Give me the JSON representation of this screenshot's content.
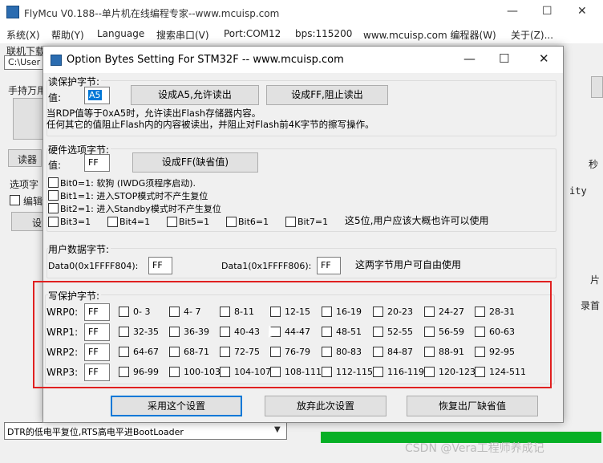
{
  "app": {
    "title": "FlyMcu V0.188--单片机在线编程专家--www.mcuisp.com",
    "menu": [
      "系统(X)",
      "帮助(Y)",
      "Language",
      "搜索串口(V)",
      "Port:COM12",
      "bps:115200",
      "www.mcuisp.com 编程器(W)",
      "关于(Z)..."
    ],
    "left_texts": {
      "online": "联机下载时的程序文件:",
      "path": "C:\\User",
      "handheld": "手持万用",
      "reader": "读器",
      "options": "选项字",
      "edit": "编辑",
      "set": "设"
    },
    "right_texts": {
      "r1": "秒",
      "r2": "ity",
      "r3": "片",
      "r4": "录首"
    },
    "bottom_combo": "DTR的低电平复位,RTS高电平进BootLoader",
    "watermark": "CSDN @Vera工程师养成记"
  },
  "dialog": {
    "title": "Option Bytes Setting For STM32F -- www.mcuisp.com",
    "read_protect": {
      "group_label": "读保护字节:",
      "value_label": "值:",
      "value": "A5",
      "btn_allow": "设成A5,允许读出",
      "btn_block": "设成FF,阻止读出",
      "note1": "当RDP值等于0xA5时，允许读出Flash存储器内容。",
      "note2": "任何其它的值阻止Flash内的内容被读出，并阻止对Flash前4K字节的擦写操作。"
    },
    "hw_options": {
      "group_label": "硬件选项字节:",
      "value_label": "值:",
      "value": "FF",
      "btn_default": "设成FF(缺省值)",
      "bit0": "Bit0=1: 软狗 (IWDG须程序启动).",
      "bit1": "Bit1=1: 进入STOP模式时不产生复位",
      "bit2": "Bit2=1: 进入Standby模式时不产生复位",
      "bit3": "Bit3=1",
      "bit4": "Bit4=1",
      "bit5": "Bit5=1",
      "bit6": "Bit6=1",
      "bit7": "Bit7=1",
      "note": "这5位,用户应该大概也许可以使用"
    },
    "user_data": {
      "group_label": "用户数据字节:",
      "data0_label": "Data0(0x1FFFF804):",
      "data0": "FF",
      "data1_label": "Data1(0x1FFFF806):",
      "data1": "FF",
      "note": "这两字节用户可自由使用"
    },
    "write_protect": {
      "group_label": "写保护字节:",
      "rows": [
        {
          "label": "WRP0:",
          "value": "FF",
          "ranges": [
            "0- 3",
            "4- 7",
            "8-11",
            "12-15",
            "16-19",
            "20-23",
            "24-27",
            "28-31"
          ]
        },
        {
          "label": "WRP1:",
          "value": "FF",
          "ranges": [
            "32-35",
            "36-39",
            "40-43",
            "44-47",
            "48-51",
            "52-55",
            "56-59",
            "60-63"
          ]
        },
        {
          "label": "WRP2:",
          "value": "FF",
          "ranges": [
            "64-67",
            "68-71",
            "72-75",
            "76-79",
            "80-83",
            "84-87",
            "88-91",
            "92-95"
          ]
        },
        {
          "label": "WRP3:",
          "value": "FF",
          "ranges": [
            "96-99",
            "100-103",
            "104-107",
            "108-111",
            "112-115",
            "116-119",
            "120-123",
            "124-511"
          ]
        }
      ]
    },
    "buttons": {
      "apply": "采用这个设置",
      "discard": "放弃此次设置",
      "restore": "恢复出厂缺省值"
    }
  }
}
